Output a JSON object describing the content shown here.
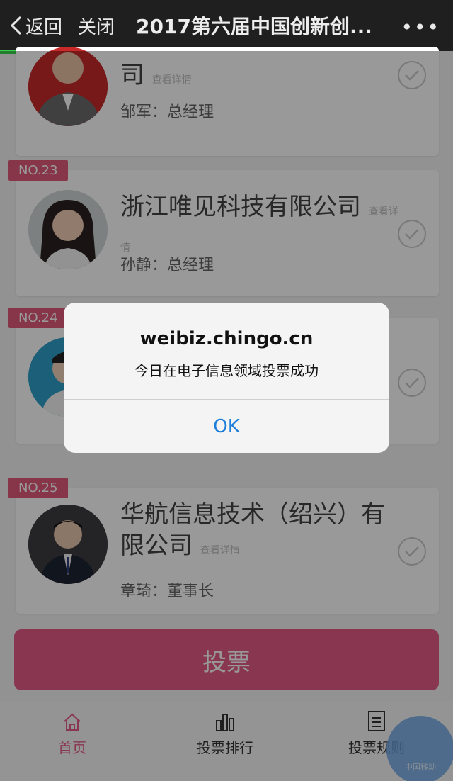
{
  "topbar": {
    "back_label": "返回",
    "close_label": "关闭",
    "title": "2017第六届中国创新创...",
    "more_label": "•••"
  },
  "entries": [
    {
      "company": "司",
      "detail": "查看详情",
      "contact": "邹军：总经理"
    },
    {
      "badge": "NO.23",
      "company": "浙江唯见科技有限公司",
      "detail": "查看详情",
      "contact": "孙静：总经理"
    },
    {
      "badge": "NO.24"
    },
    {
      "badge": "NO.25",
      "company": "华航信息技术（绍兴）有限公司",
      "detail": "查看详情",
      "contact": "章琦：董事长"
    }
  ],
  "vote_button": {
    "label": "投票"
  },
  "tabs": [
    {
      "label": "首页",
      "active": true
    },
    {
      "label": "投票排行"
    },
    {
      "label": "投票规则"
    }
  ],
  "watermark": {
    "text": "中国移动"
  },
  "alert": {
    "title": "weibiz.chingo.cn",
    "message": "今日在电子信息领域投票成功",
    "ok_label": "OK"
  },
  "colors": {
    "accent": "#e55d87",
    "progress": "#3ad14d",
    "link": "#1d7fd9"
  }
}
